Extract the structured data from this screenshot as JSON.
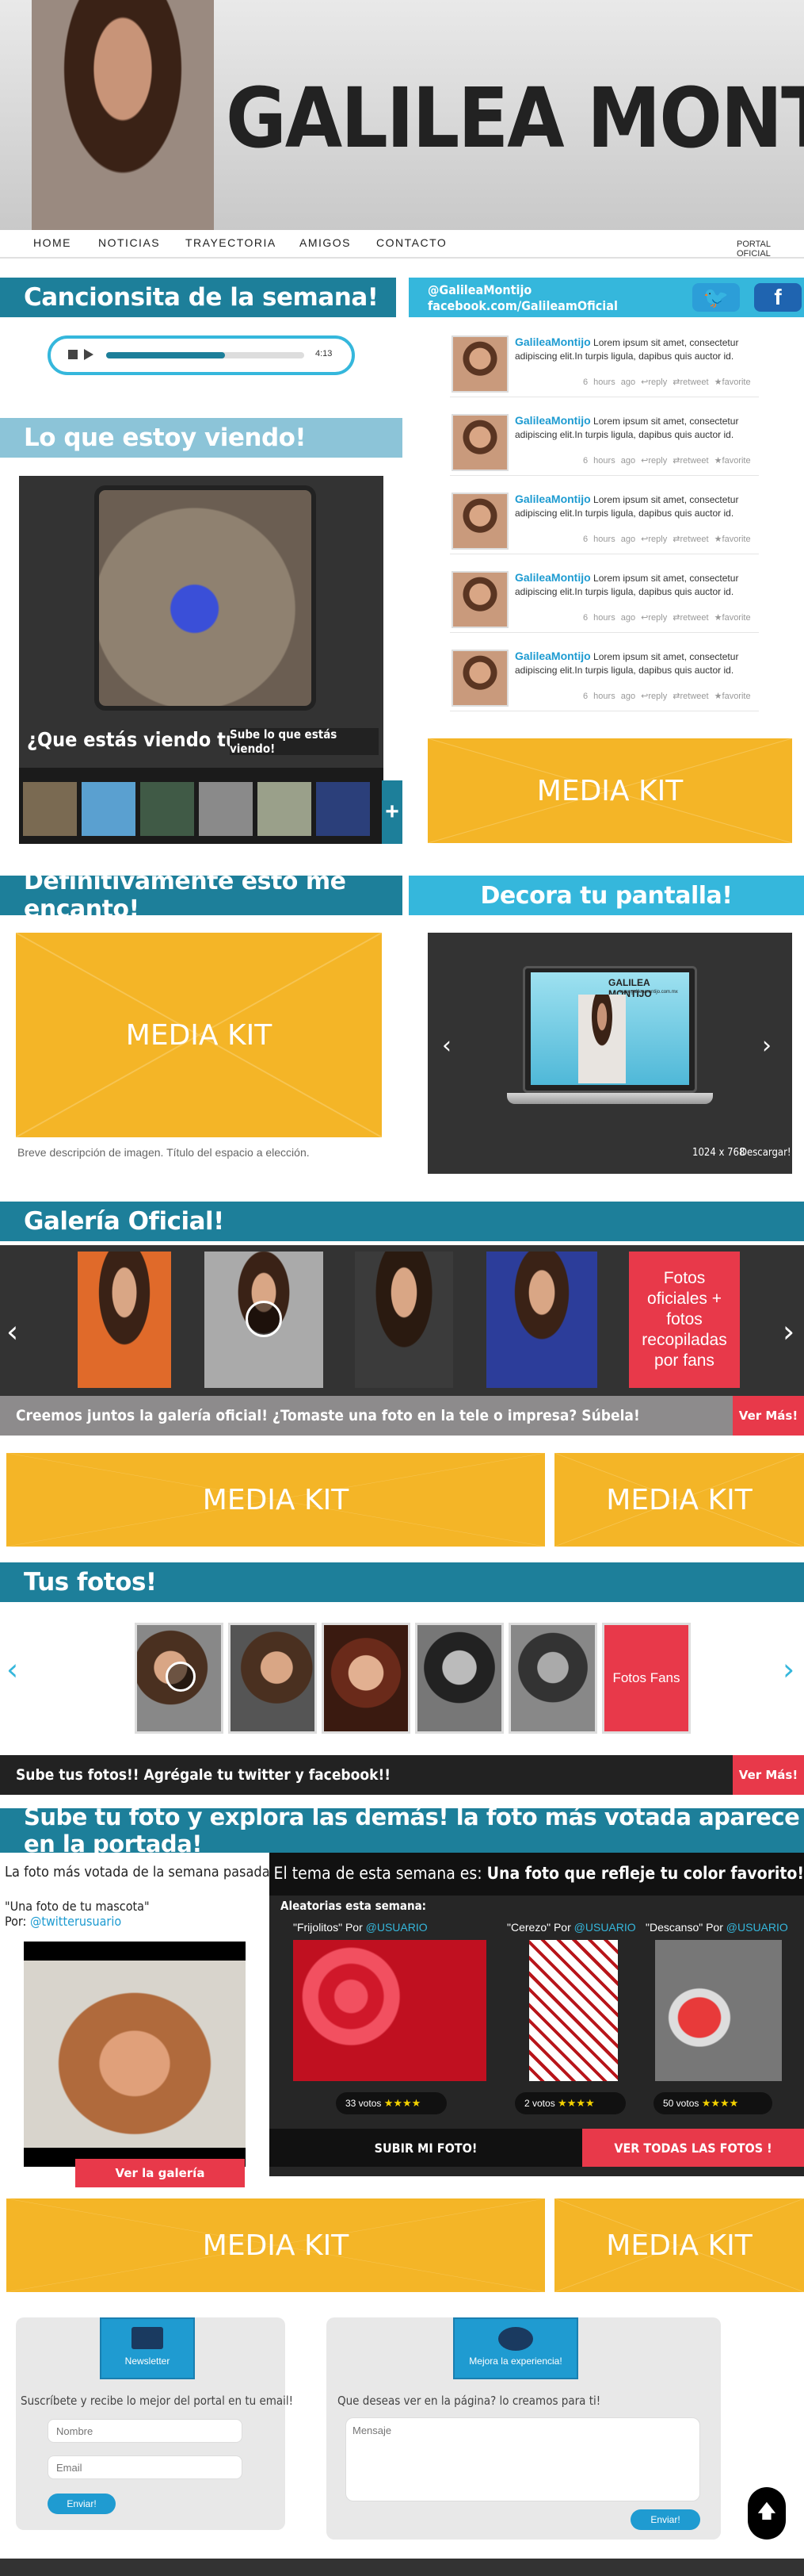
{
  "header": {
    "site_title": "GALILEA MONTIJO",
    "portal_label": "PORTAL OFICIAL",
    "nav": [
      "HOME",
      "NOTICIAS",
      "TRAYECTORIA",
      "AMIGOS",
      "CONTACTO"
    ]
  },
  "song": {
    "title": "Cancionsita de la semana!",
    "time": "4:13",
    "progress": 0.6
  },
  "social": {
    "handle": "@GalileaMontijo",
    "facebook": "facebook.com/GalileamOficial",
    "tweets": [
      {
        "name": "GalileaMontijo",
        "text": "Lorem ipsum  sit amet, consectetur adipiscing elit.In turpis ligula, dapibus quis auctor id.",
        "time": "6 hours ago",
        "reply": "reply",
        "retweet": "retweet",
        "favorite": "favorite"
      },
      {
        "name": "GalileaMontijo",
        "text": "Lorem ipsum  sit amet, consectetur adipiscing elit.In turpis ligula, dapibus quis auctor id.",
        "time": "6 hours ago",
        "reply": "reply",
        "retweet": "retweet",
        "favorite": "favorite"
      },
      {
        "name": "GalileaMontijo",
        "text": "Lorem ipsum  sit amet, consectetur adipiscing elit.In turpis ligula, dapibus quis auctor id.",
        "time": "6 hours ago",
        "reply": "reply",
        "retweet": "retweet",
        "favorite": "favorite"
      },
      {
        "name": "GalileaMontijo",
        "text": "Lorem ipsum  sit amet, consectetur adipiscing elit.In turpis ligula, dapibus quis auctor id.",
        "time": "6 hours ago",
        "reply": "reply",
        "retweet": "retweet",
        "favorite": "favorite"
      },
      {
        "name": "GalileaMontijo",
        "text": "Lorem ipsum  sit amet, consectetur adipiscing elit.In turpis ligula, dapibus quis auctor id.",
        "time": "6 hours ago",
        "reply": "reply",
        "retweet": "retweet",
        "favorite": "favorite"
      }
    ]
  },
  "watching": {
    "title": "Lo que estoy viendo!",
    "question": "¿Que estás viendo tu!?",
    "button": "Sube lo que estás viendo!",
    "plus": "+"
  },
  "media_kit_label": "MEDIA KIT",
  "loved": {
    "title": "Definitivamente esto me encanto!",
    "caption": "Breve descripción de imagen. Título del espacio a elección."
  },
  "wallpaper": {
    "title": "Decora tu pantalla!",
    "screen_title": "GALILEA MONTIJO",
    "screen_url": "www.galileamontijo.com.mx",
    "resolution": "1024 x 768",
    "download": "Descargar!"
  },
  "gallery": {
    "title": "Galería Oficial!",
    "fans_tile": "Fotos oficiales + fotos recopiladas por fans",
    "bar_text": "Creemos juntos la galería oficial!  ¿Tomaste una foto en la tele o impresa? Súbela!",
    "more": "Ver Más!"
  },
  "your_photos": {
    "title": "Tus fotos!",
    "fans_tile": "Fotos Fans",
    "bar_text": "Sube tus fotos!! Agrégale tu twitter y facebook!!",
    "more": "Ver Más!"
  },
  "contest": {
    "title": "Sube tu foto y explora las demás!  la foto más votada aparece en la portada!",
    "winner_label": "La foto más votada de la semana pasada:",
    "winner_caption": "\"Una foto de tu mascota\"",
    "by": "Por:",
    "winner_user": "@twitterusuario",
    "see_gallery": "Ver la galería",
    "theme_label": "El tema de esta semana es:",
    "theme_value": "Una foto que refleje tu color favorito!",
    "random_label": "Aleatorias esta semana:",
    "entries": [
      {
        "name": "\"Frijolitos\"",
        "by": "Por",
        "user": "@USUARIO",
        "votes": "33 votos",
        "stars": "★★★★"
      },
      {
        "name": "\"Cerezo\"",
        "by": "Por",
        "user": "@USUARIO",
        "votes": "2 votos",
        "stars": "★★★★"
      },
      {
        "name": "\"Descanso\"",
        "by": "Por",
        "user": "@USUARIO",
        "votes": "50 votos",
        "stars": "★★★★"
      }
    ],
    "upload": "SUBIR MI FOTO!",
    "see_all": "VER TODAS LAS FOTOS !"
  },
  "newsletter": {
    "badge": "Newsletter",
    "subtitle": "Suscríbete y recibe lo mejor del portal en tu email!",
    "name_placeholder": "Nombre",
    "email_placeholder": "Email",
    "send": "Enviar!"
  },
  "feedback": {
    "badge": "Mejora la experiencia!",
    "subtitle": "Que deseas ver en la página? lo creamos para ti!",
    "message_placeholder": "Mensaje",
    "send": "Enviar!"
  },
  "colors": {
    "teal": "#1d7f9a",
    "cyan": "#35b7dc",
    "media_kit": "#f4b527",
    "red": "#e8394a",
    "dark": "#333333"
  }
}
